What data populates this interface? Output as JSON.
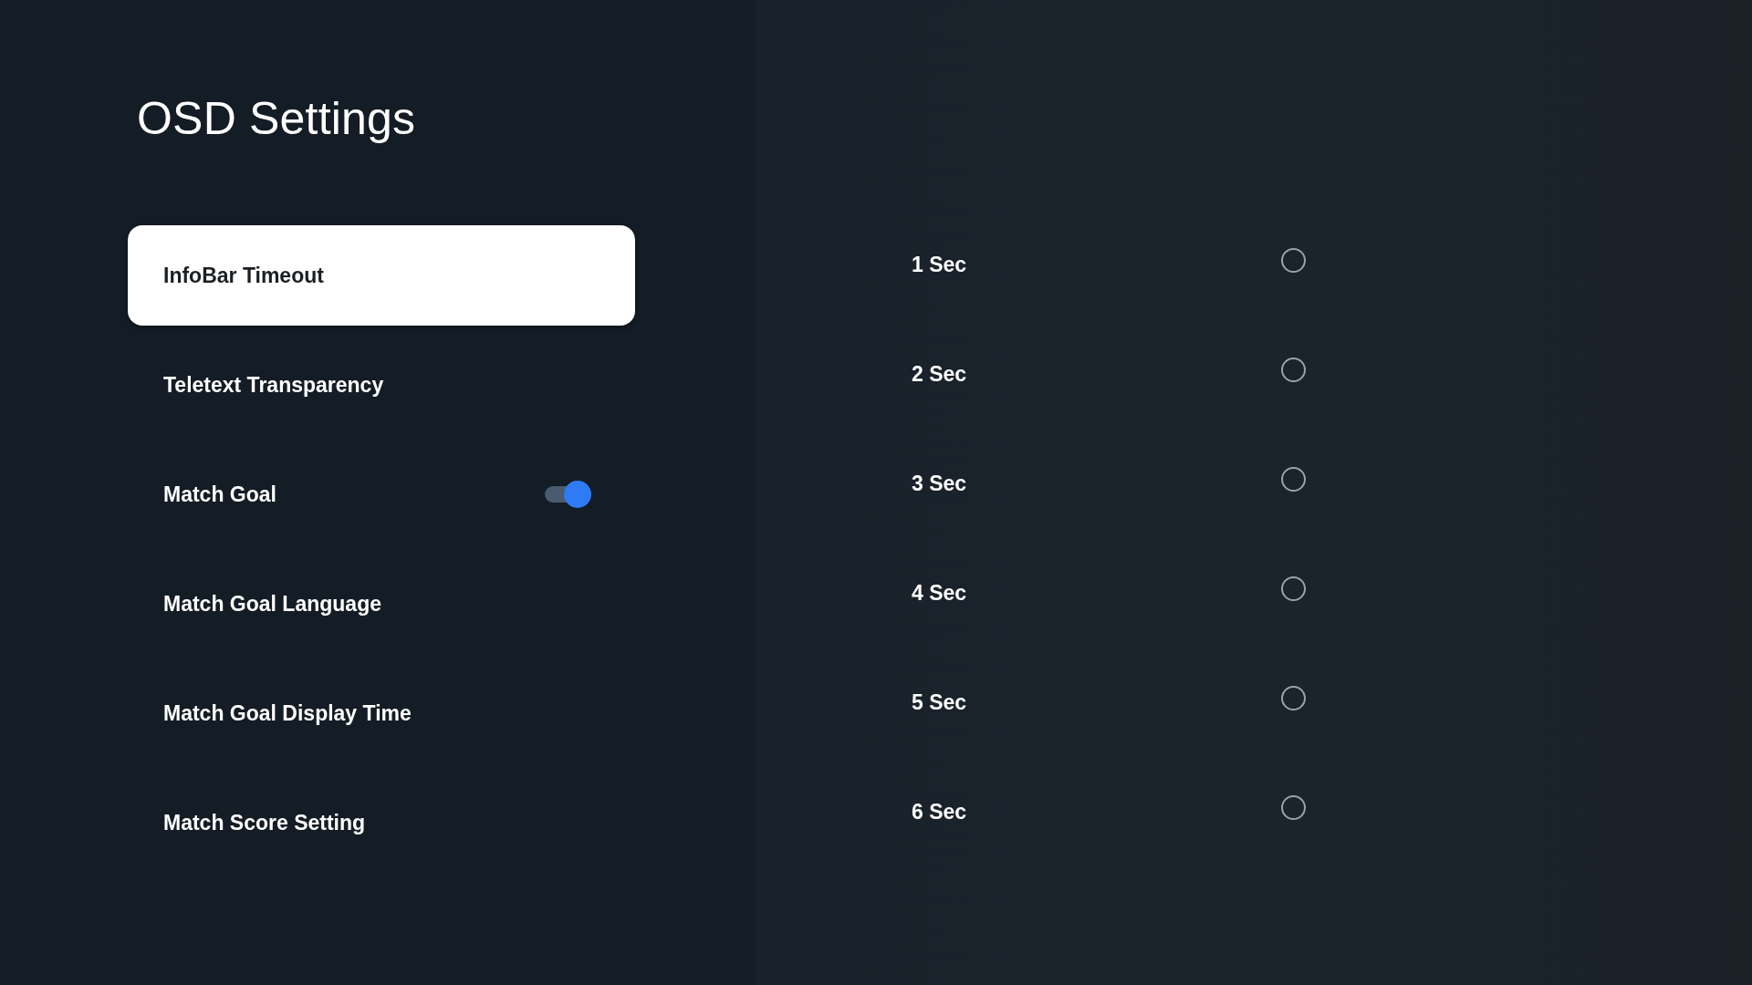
{
  "title": "OSD Settings",
  "menu": [
    {
      "label": "InfoBar Timeout",
      "selected": true,
      "kind": "item"
    },
    {
      "label": "Teletext Transparency",
      "selected": false,
      "kind": "item"
    },
    {
      "label": "Match Goal",
      "selected": false,
      "kind": "toggle",
      "on": true
    },
    {
      "label": "Match Goal Language",
      "selected": false,
      "kind": "item"
    },
    {
      "label": "Match Goal Display Time",
      "selected": false,
      "kind": "item"
    },
    {
      "label": "Match Score Setting",
      "selected": false,
      "kind": "item"
    }
  ],
  "options": [
    {
      "label": "1 Sec",
      "selected": false
    },
    {
      "label": "2 Sec",
      "selected": false
    },
    {
      "label": "3 Sec",
      "selected": false
    },
    {
      "label": "4 Sec",
      "selected": false
    },
    {
      "label": "5 Sec",
      "selected": false
    },
    {
      "label": "6 Sec",
      "selected": false
    }
  ]
}
